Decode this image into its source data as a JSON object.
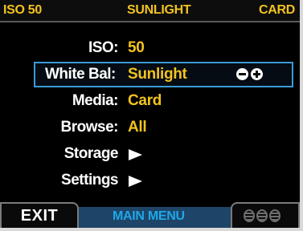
{
  "status": {
    "iso": "ISO 50",
    "white_balance": "SUNLIGHT",
    "media": "CARD"
  },
  "menu": {
    "items": [
      {
        "label": "ISO:",
        "value": "50",
        "type": "value"
      },
      {
        "label": "White Bal:",
        "value": "Sunlight",
        "type": "value",
        "selected": true,
        "controls": [
          "minus-icon",
          "plus-icon"
        ]
      },
      {
        "label": "Media:",
        "value": "Card",
        "type": "value"
      },
      {
        "label": "Browse:",
        "value": "All",
        "type": "value"
      },
      {
        "label": "Storage",
        "type": "submenu",
        "icon": "arrow-right-icon"
      },
      {
        "label": "Settings",
        "type": "submenu",
        "icon": "arrow-right-icon"
      }
    ]
  },
  "bottom": {
    "exit_label": "EXIT",
    "title": "MAIN MENU",
    "dial_icon": "dial-icon"
  },
  "colors": {
    "value": "#f3c31f",
    "label": "#ffffff",
    "selection": "#3a9bd6",
    "bar": "#1e4468",
    "title": "#1fa8e8"
  }
}
